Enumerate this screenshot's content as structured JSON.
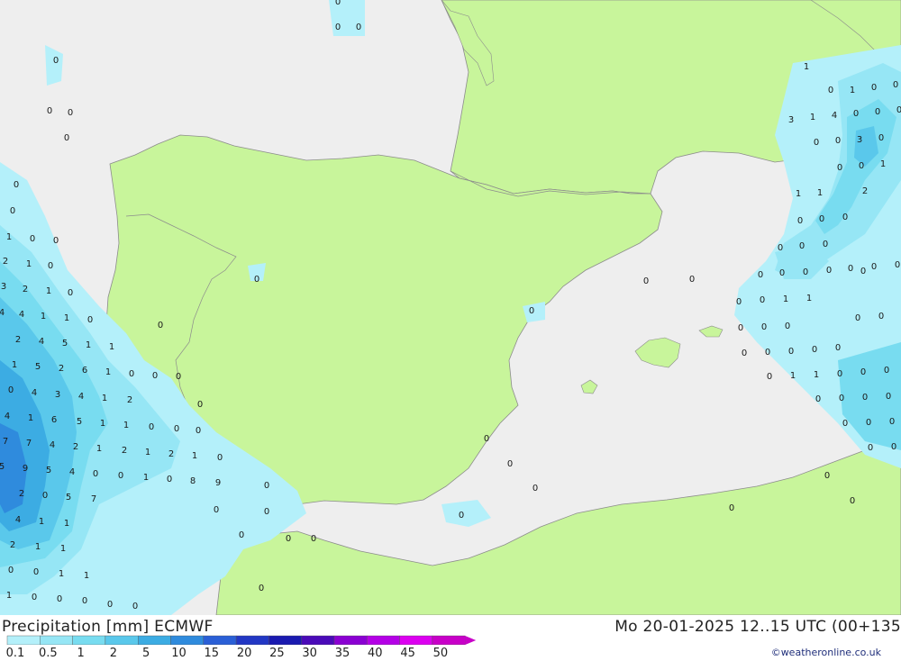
{
  "title": "Precipitation [mm] ECMWF",
  "run_info": "Mo 20-01-2025 12..15 UTC (00+135",
  "credit": "©weatheronline.co.uk",
  "legend": {
    "labels": [
      "0.1",
      "0.5",
      "1",
      "2",
      "5",
      "10",
      "15",
      "20",
      "25",
      "30",
      "35",
      "40",
      "45",
      "50"
    ],
    "colors": [
      "#b4f0fa",
      "#96e6f5",
      "#78dcf0",
      "#5ac8eb",
      "#3cace3",
      "#2f8bdd",
      "#2a5fd6",
      "#2237c4",
      "#1a1ab0",
      "#4a0ab8",
      "#8a00d2",
      "#b400e6",
      "#dc00f0",
      "#c800c8"
    ]
  },
  "colors": {
    "land": "#c8f59b",
    "sea": "#eeeeee",
    "border": "#8c8c8c"
  },
  "map_values": [
    "0",
    "0",
    "0",
    "0",
    "0",
    "0",
    "0",
    "0",
    "0",
    "1",
    "0",
    "0",
    "2",
    "1",
    "0",
    "3",
    "2",
    "1",
    "0",
    "4",
    "4",
    "1",
    "1",
    "0",
    "2",
    "4",
    "5",
    "1",
    "1",
    "1",
    "5",
    "2",
    "6",
    "1",
    "0",
    "0",
    "0",
    "4",
    "3",
    "4",
    "1",
    "2",
    "4",
    "1",
    "6",
    "5",
    "1",
    "1",
    "0",
    "0",
    "0",
    "7",
    "7",
    "4",
    "2",
    "1",
    "2",
    "1",
    "2",
    "1",
    "0",
    "5",
    "9",
    "5",
    "4",
    "0",
    "0",
    "1",
    "0",
    "8",
    "9",
    "2",
    "0",
    "5",
    "7",
    "4",
    "1",
    "1",
    "2",
    "1",
    "1",
    "0",
    "0",
    "1",
    "1",
    "1",
    "0",
    "0",
    "0",
    "0",
    "0",
    "0",
    "0",
    "0",
    "0",
    "0",
    "0",
    "0",
    "0",
    "0",
    "0",
    "0",
    "0",
    "0",
    "0",
    "0",
    "0",
    "0",
    "0",
    "0",
    "1",
    "0",
    "1",
    "0",
    "0",
    "3",
    "1",
    "4",
    "0",
    "0",
    "0",
    "0",
    "0",
    "3",
    "0",
    "0",
    "0",
    "1",
    "1",
    "1",
    "2",
    "0",
    "0",
    "0",
    "0",
    "0",
    "0",
    "0",
    "0",
    "0",
    "0",
    "0",
    "0",
    "0",
    "0",
    "0",
    "1",
    "1",
    "0",
    "0",
    "0",
    "0",
    "0",
    "0",
    "0",
    "0",
    "0",
    "1",
    "1",
    "0",
    "0",
    "0",
    "0",
    "0",
    "0",
    "0",
    "0",
    "0",
    "0",
    "0",
    "0",
    "0",
    "0",
    "0",
    "0",
    "0",
    "0",
    "0",
    "0"
  ]
}
